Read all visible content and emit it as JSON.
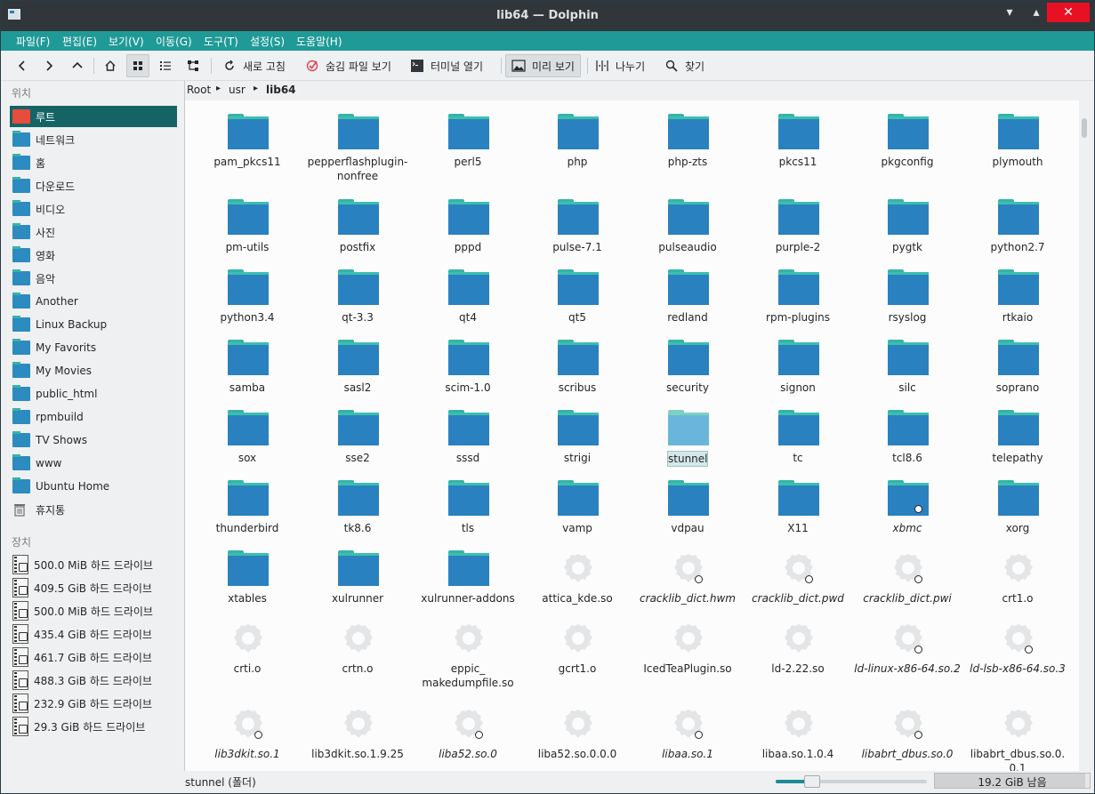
{
  "window": {
    "title": "lib64 — Dolphin",
    "min": "▾",
    "max": "▴",
    "close": "✕"
  },
  "menu": [
    "파일(F)",
    "편집(E)",
    "보기(V)",
    "이동(G)",
    "도구(T)",
    "설정(S)",
    "도움말(H)"
  ],
  "toolbar": {
    "reload": "새로 고침",
    "hidden": "숨김 파일 보기",
    "terminal": "터미널 열기",
    "preview": "미리 보기",
    "split": "나누기",
    "find": "찾기"
  },
  "sidebar": {
    "places_title": "위치",
    "places": [
      "루트",
      "네트워크",
      "홈",
      "다운로드",
      "비디오",
      "사진",
      "영화",
      "음악",
      "Another",
      "Linux Backup",
      "My Favorits",
      "My Movies",
      "public_html",
      "rpmbuild",
      "TV Shows",
      "www",
      "Ubuntu Home",
      "휴지통"
    ],
    "devices_title": "장치",
    "devices": [
      "500.0 MiB 하드 드라이브",
      "409.5 GiB 하드 드라이브",
      "500.0 MiB 하드 드라이브",
      "435.4 GiB 하드 드라이브",
      "461.7 GiB 하드 드라이브",
      "488.3 GiB 하드 드라이브",
      "232.9 GiB 하드 드라이브",
      "29.3 GiB 하드 드라이브"
    ]
  },
  "breadcrumb": [
    "Root",
    "usr",
    "lib64"
  ],
  "files": [
    {
      "name": "pam_pkcs11",
      "kind": "folder"
    },
    {
      "name": "pepperflashplugin-nonfree",
      "kind": "folder"
    },
    {
      "name": "perl5",
      "kind": "folder"
    },
    {
      "name": "php",
      "kind": "folder"
    },
    {
      "name": "php-zts",
      "kind": "folder"
    },
    {
      "name": "pkcs11",
      "kind": "folder"
    },
    {
      "name": "pkgconfig",
      "kind": "folder"
    },
    {
      "name": "plymouth",
      "kind": "folder"
    },
    {
      "name": "pm-utils",
      "kind": "folder"
    },
    {
      "name": "postfix",
      "kind": "folder"
    },
    {
      "name": "pppd",
      "kind": "folder"
    },
    {
      "name": "pulse-7.1",
      "kind": "folder"
    },
    {
      "name": "pulseaudio",
      "kind": "folder"
    },
    {
      "name": "purple-2",
      "kind": "folder"
    },
    {
      "name": "pygtk",
      "kind": "folder"
    },
    {
      "name": "python2.7",
      "kind": "folder"
    },
    {
      "name": "python3.4",
      "kind": "folder"
    },
    {
      "name": "qt-3.3",
      "kind": "folder"
    },
    {
      "name": "qt4",
      "kind": "folder"
    },
    {
      "name": "qt5",
      "kind": "folder"
    },
    {
      "name": "redland",
      "kind": "folder"
    },
    {
      "name": "rpm-plugins",
      "kind": "folder"
    },
    {
      "name": "rsyslog",
      "kind": "folder"
    },
    {
      "name": "rtkaio",
      "kind": "folder"
    },
    {
      "name": "samba",
      "kind": "folder"
    },
    {
      "name": "sasl2",
      "kind": "folder"
    },
    {
      "name": "scim-1.0",
      "kind": "folder"
    },
    {
      "name": "scribus",
      "kind": "folder"
    },
    {
      "name": "security",
      "kind": "folder"
    },
    {
      "name": "signon",
      "kind": "folder"
    },
    {
      "name": "silc",
      "kind": "folder"
    },
    {
      "name": "soprano",
      "kind": "folder"
    },
    {
      "name": "sox",
      "kind": "folder"
    },
    {
      "name": "sse2",
      "kind": "folder"
    },
    {
      "name": "sssd",
      "kind": "folder"
    },
    {
      "name": "strigi",
      "kind": "folder"
    },
    {
      "name": "stunnel",
      "kind": "folder",
      "selected": true
    },
    {
      "name": "tc",
      "kind": "folder"
    },
    {
      "name": "tcl8.6",
      "kind": "folder"
    },
    {
      "name": "telepathy",
      "kind": "folder"
    },
    {
      "name": "thunderbird",
      "kind": "folder"
    },
    {
      "name": "tk8.6",
      "kind": "folder"
    },
    {
      "name": "tls",
      "kind": "folder"
    },
    {
      "name": "vamp",
      "kind": "folder"
    },
    {
      "name": "vdpau",
      "kind": "folder"
    },
    {
      "name": "X11",
      "kind": "folder"
    },
    {
      "name": "xbmc",
      "kind": "folder",
      "link": true
    },
    {
      "name": "xorg",
      "kind": "folder"
    },
    {
      "name": "xtables",
      "kind": "folder"
    },
    {
      "name": "xulrunner",
      "kind": "folder"
    },
    {
      "name": "xulrunner-addons",
      "kind": "folder"
    },
    {
      "name": "attica_kde.so",
      "kind": "file"
    },
    {
      "name": "cracklib_dict.hwm",
      "kind": "file",
      "link": true
    },
    {
      "name": "cracklib_dict.pwd",
      "kind": "file",
      "link": true
    },
    {
      "name": "cracklib_dict.pwi",
      "kind": "file",
      "link": true
    },
    {
      "name": "crt1.o",
      "kind": "file"
    },
    {
      "name": "crti.o",
      "kind": "file"
    },
    {
      "name": "crtn.o",
      "kind": "file"
    },
    {
      "name": "eppic_makedumpfile.so",
      "kind": "file",
      "display": "eppic_\nmakedumpfile.so"
    },
    {
      "name": "gcrt1.o",
      "kind": "file"
    },
    {
      "name": "IcedTeaPlugin.so",
      "kind": "file"
    },
    {
      "name": "ld-2.22.so",
      "kind": "file"
    },
    {
      "name": "ld-linux-x86-64.so.2",
      "kind": "file",
      "link": true
    },
    {
      "name": "ld-lsb-x86-64.so.3",
      "kind": "file",
      "link": true
    },
    {
      "name": "lib3dkit.so.1",
      "kind": "file",
      "link": true
    },
    {
      "name": "lib3dkit.so.1.9.25",
      "kind": "file"
    },
    {
      "name": "liba52.so.0",
      "kind": "file",
      "link": true
    },
    {
      "name": "liba52.so.0.0.0",
      "kind": "file"
    },
    {
      "name": "libaa.so.1",
      "kind": "file",
      "link": true
    },
    {
      "name": "libaa.so.1.0.4",
      "kind": "file"
    },
    {
      "name": "libabrt_dbus.so.0",
      "kind": "file",
      "link": true
    },
    {
      "name": "libabrt_dbus.so.0.0.1",
      "kind": "file",
      "display": "libabrt_dbus.so.0.\n0.1"
    }
  ],
  "status": {
    "text": "stunnel (폴더)",
    "free": "19.2 GiB 남음",
    "zoom_fraction": 0.2,
    "used_fraction": 0.97
  },
  "colors": {
    "menubar": "#1f9a97",
    "folder": "#2a81bf",
    "folder_tab": "#35b3a8",
    "selection": "#146466"
  }
}
